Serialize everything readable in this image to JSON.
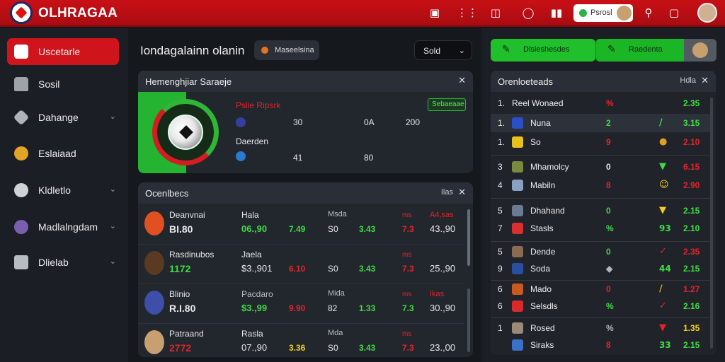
{
  "app": {
    "title": "OLHRAGAA"
  },
  "topbar": {
    "icons": [
      "shop-icon",
      "grid-icon",
      "shield-icon",
      "clock-icon",
      "bookmark-icon"
    ],
    "user_label": "Psrosl"
  },
  "sidebar": {
    "items": [
      {
        "label": "Uscetarle",
        "icon": "home-icon",
        "active": true
      },
      {
        "label": "Sosil",
        "icon": "house-icon"
      },
      {
        "label": "Dahange",
        "icon": "tag-icon",
        "chevron": true
      },
      {
        "label": "Eslaiaad",
        "icon": "trophy-icon"
      },
      {
        "label": "Kldletlo",
        "icon": "ball-icon",
        "chevron": true
      },
      {
        "label": "Madlalngdam",
        "icon": "medal-icon",
        "chevron": true
      },
      {
        "label": "Dlielab",
        "icon": "tools-icon",
        "chevron": true
      }
    ]
  },
  "header": {
    "title": "Iondagalainn olanin",
    "live_label": "Maseelsina",
    "sort_label": "Sold"
  },
  "match_card": {
    "title": "Hemenghjiar Saraeje",
    "tag": "Sebaeaae",
    "team1": {
      "name": "Pslie Ripsrk",
      "v1": "30",
      "v2": "0A",
      "v3": "200"
    },
    "team2": {
      "name": "Daerden",
      "v1": "41",
      "v2": "80"
    }
  },
  "players_card": {
    "title": "Ocenlbecs",
    "extra": "Ilas",
    "rows": [
      {
        "name": "Deanvnai",
        "sub": "BI.80",
        "role": "Hala",
        "v1": "06.,90",
        "v2": "7.49",
        "col3h": "Msda",
        "v3": "S0",
        "v4": "3.43",
        "h5": "ms",
        "v5": "7.3",
        "h6": "A4,sas",
        "v6": "43.,90"
      },
      {
        "name": "Rasdinubos",
        "sub": "1172",
        "role": "Jaela",
        "v1": "$3.,901",
        "v2": "6.10",
        "col3h": "",
        "v3": "S0",
        "v4": "3.43",
        "h5": "ms",
        "v5": "7.3",
        "h6": "",
        "v6": "25.,90"
      },
      {
        "name": "Blinio",
        "sub": "R.I.80",
        "role": "Pacdaro",
        "v1": "$3.,99",
        "v2": "9.90",
        "col3h": "Mida",
        "v3": "82",
        "v4": "1.33",
        "h5": "ms",
        "v5": "7.3",
        "h6": "Ikas",
        "v6": "30.,90"
      },
      {
        "name": "Patraand",
        "sub": "2772",
        "role": "Rasla",
        "v1": "07.,90",
        "v2": "3.36",
        "col3h": "Mda",
        "v3": "S0",
        "v4": "3.43",
        "h5": "ms",
        "v5": "7.3",
        "h6": "",
        "v6": "23.,00"
      }
    ]
  },
  "right_panel": {
    "button1": "Dlsieshesdes",
    "button2": "Raedenta",
    "title": "Orenloeteads",
    "extra": "Hdla",
    "rows": [
      {
        "n": "1.",
        "name": "Reel Wonaed",
        "c1": "%",
        "c2": "",
        "c3": "2.35",
        "c1_color": "#e1252b",
        "c3_color": "#3fdc44"
      },
      {
        "n": "1.",
        "name": "Nuna",
        "c1": "2",
        "c2": "∕",
        "c3": "3.15",
        "c1_color": "#3fdc44",
        "c2_color": "#3fdc44",
        "c3_color": "#3fdc44"
      },
      {
        "n": "1.",
        "name": "So",
        "c1": "9",
        "c2": "●",
        "c3": "2.10",
        "c1_color": "#e1252b",
        "c2_color": "#e0a020",
        "c3_color": "#e1252b"
      },
      {
        "n": "3",
        "name": "Mhamolcy",
        "c1": "0",
        "c2": "▼",
        "c3": "6.15",
        "c1_color": "#e6e8eb",
        "c2_color": "#3fdc44",
        "c3_color": "#e1252b"
      },
      {
        "n": "4",
        "name": "Mabiln",
        "c1": "8",
        "c2": "☺",
        "c3": "2.90",
        "c1_color": "#e1252b",
        "c2_color": "#f2cc1e",
        "c3_color": "#e1252b"
      },
      {
        "n": "5",
        "name": "Dhahand",
        "c1": "0",
        "c2": "▼",
        "c3": "2.15",
        "c1_color": "#3fdc44",
        "c2_color": "#f2cc1e",
        "c3_color": "#3fdc44"
      },
      {
        "n": "7",
        "name": "Stasls",
        "c1": "%",
        "c2": "93",
        "c3": "2.10",
        "c1_color": "#3fdc44",
        "c2_color": "#3fdc44",
        "c3_color": "#3fdc44"
      },
      {
        "n": "5",
        "name": "Dende",
        "c1": "0",
        "c2": "✓",
        "c3": "2.35",
        "c1_color": "#3fdc44",
        "c2_color": "#e1252b",
        "c3_color": "#e1252b"
      },
      {
        "n": "9",
        "name": "Soda",
        "c1": "◆",
        "c2": "44",
        "c3": "2.15",
        "c1_color": "#b0b5bc",
        "c2_color": "#3fdc44",
        "c3_color": "#3fdc44"
      },
      {
        "n": "6",
        "name": "Mado",
        "c1": "0",
        "c2": "∕",
        "c3": "1.27",
        "c1_color": "#e1252b",
        "c2_color": "#e0a020",
        "c3_color": "#e1252b"
      },
      {
        "n": "6",
        "name": "Selsdls",
        "c1": "%",
        "c2": "✓",
        "c3": "2.16",
        "c1_color": "#3fdc44",
        "c2_color": "#e1252b",
        "c3_color": "#3fdc44"
      },
      {
        "n": "1",
        "name": "Rosed",
        "c1": "%",
        "c2": "▼",
        "c3": "1.35",
        "c1_color": "#b0b5bc",
        "c2_color": "#e1252b",
        "c3_color": "#f2cc1e"
      },
      {
        "n": "",
        "name": "Siraks",
        "c1": "8",
        "c2": "33",
        "c3": "2.15",
        "c1_color": "#e1252b",
        "c2_color": "#3fdc44",
        "c3_color": "#3fdc44"
      }
    ]
  }
}
